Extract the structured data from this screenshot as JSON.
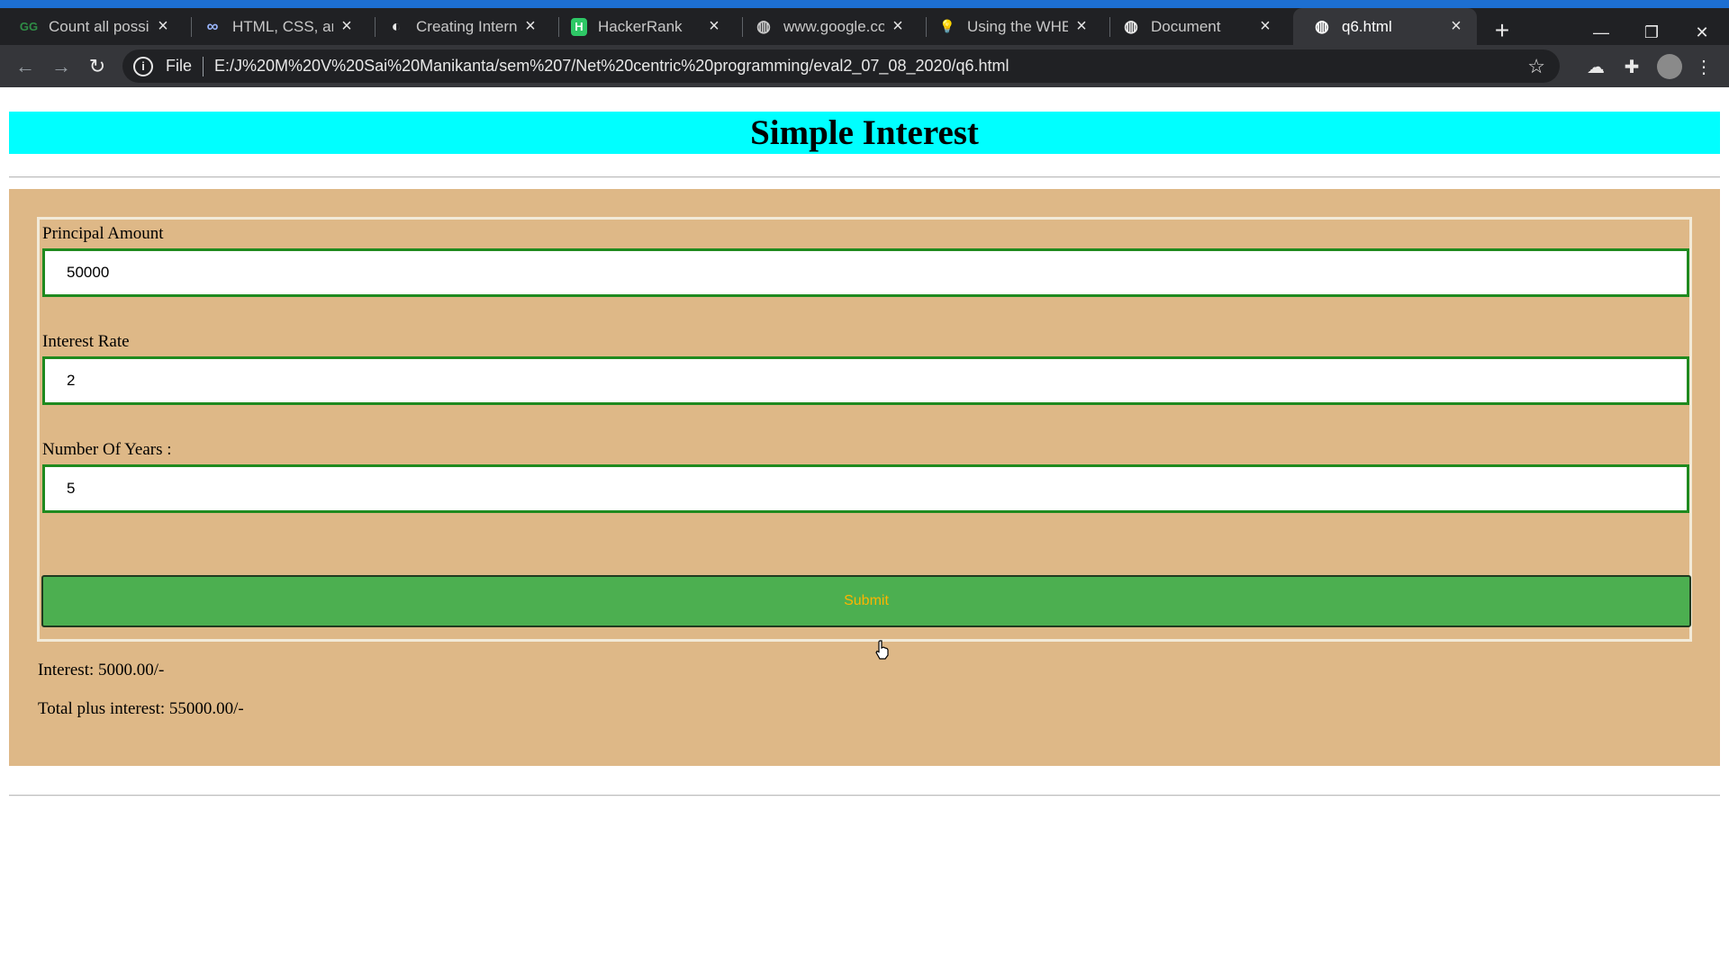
{
  "browser": {
    "tabs": [
      {
        "title": "Count all possible",
        "favicon": "GG",
        "favicon_name": "geeksforgeeks-icon"
      },
      {
        "title": "HTML, CSS, and Ja",
        "favicon": "∞",
        "favicon_name": "codepen-icon"
      },
      {
        "title": "Creating Internal &",
        "favicon": "◐",
        "favicon_name": "site-icon"
      },
      {
        "title": "HackerRank",
        "favicon": "H",
        "favicon_name": "hackerrank-icon"
      },
      {
        "title": "www.google.com",
        "favicon": "◍",
        "favicon_name": "globe-icon"
      },
      {
        "title": "Using the WHERE",
        "favicon": "💡",
        "favicon_name": "lightbulb-icon"
      },
      {
        "title": "Document",
        "favicon": "◍",
        "favicon_name": "globe-icon"
      },
      {
        "title": "q6.html",
        "favicon": "◍",
        "favicon_name": "globe-icon",
        "active": true
      }
    ],
    "address": {
      "scheme": "File",
      "url": "E:/J%20M%20V%20Sai%20Manikanta/sem%207/Net%20centric%20programming/eval2_07_08_2020/q6.html"
    },
    "accent_color": "#1d6fd1"
  },
  "page": {
    "heading": "Simple Interest",
    "heading_bg": "#00ffff",
    "panel_bg": "#deb887",
    "form": {
      "principal_label": "Principal Amount",
      "principal_value": "50000",
      "rate_label": "Interest Rate",
      "rate_value": "2",
      "years_label": "Number Of Years :",
      "years_value": "5",
      "submit_label": "Submit",
      "submit_bg": "#4caf50",
      "submit_text_color": "#ffb400"
    },
    "results": {
      "interest": "Interest: 5000.00/-",
      "total": "Total plus interest: 55000.00/-"
    }
  }
}
